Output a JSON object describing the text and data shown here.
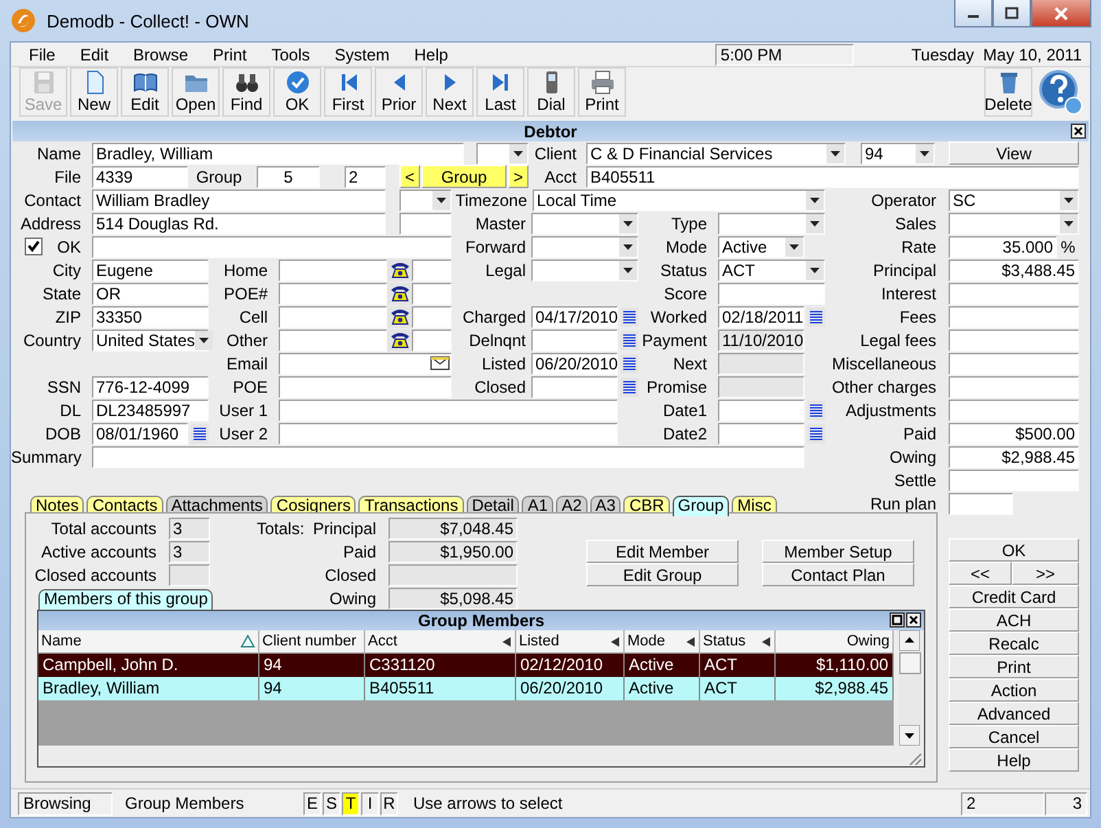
{
  "window": {
    "title": "Demodb - Collect! - OWN"
  },
  "menu": [
    "File",
    "Edit",
    "Browse",
    "Print",
    "Tools",
    "System",
    "Help"
  ],
  "clock": {
    "time": "5:00 PM",
    "date": "Tuesday  May 10, 2011"
  },
  "toolbar": [
    {
      "label": "Save",
      "disabled": true
    },
    {
      "label": "New",
      "disabled": false
    },
    {
      "label": "Edit",
      "disabled": false
    },
    {
      "label": "Open",
      "disabled": false
    },
    {
      "label": "Find",
      "disabled": false
    },
    {
      "label": "OK",
      "disabled": false
    },
    {
      "label": "First",
      "disabled": false
    },
    {
      "label": "Prior",
      "disabled": false
    },
    {
      "label": "Next",
      "disabled": false
    },
    {
      "label": "Last",
      "disabled": false
    },
    {
      "label": "Dial",
      "disabled": false
    },
    {
      "label": "Print",
      "disabled": false
    }
  ],
  "toolbar_right": [
    {
      "label": "Delete",
      "disabled": false
    }
  ],
  "debtor": {
    "title": "Debtor",
    "items": [
      {
        "kind": "label",
        "text": "Name"
      },
      {
        "kind": "field",
        "value": "Bradley, William"
      },
      {
        "kind": "combo"
      },
      {
        "kind": "label",
        "text": "Client"
      },
      {
        "kind": "combo",
        "value": "C & D Financial Services"
      },
      {
        "kind": "combo",
        "value": "94"
      },
      {
        "kind": "button",
        "label": "View",
        "highlighted": false
      },
      {
        "kind": "label",
        "text": "File"
      },
      {
        "kind": "field",
        "value": "4339"
      },
      {
        "kind": "label",
        "text": "Group"
      },
      {
        "kind": "field",
        "value": "5"
      },
      {
        "kind": "field",
        "value": "2"
      },
      {
        "kind": "button",
        "label": "<",
        "highlighted": true
      },
      {
        "kind": "button",
        "label": "Group",
        "highlighted": true
      },
      {
        "kind": "button",
        "label": ">",
        "highlighted": true
      },
      {
        "kind": "label",
        "text": "Acct"
      },
      {
        "kind": "field",
        "value": "B405511"
      },
      {
        "kind": "label",
        "text": "Contact"
      },
      {
        "kind": "field",
        "value": "William Bradley"
      },
      {
        "kind": "combo"
      },
      {
        "kind": "label",
        "text": "Timezone"
      },
      {
        "kind": "combo",
        "value": "Local Time"
      },
      {
        "kind": "label",
        "text": "Operator"
      },
      {
        "kind": "combo",
        "value": "SC"
      },
      {
        "kind": "label",
        "text": "Address"
      },
      {
        "kind": "field",
        "value": "514 Douglas Rd."
      },
      {
        "kind": "field"
      },
      {
        "kind": "label",
        "text": "Master"
      },
      {
        "kind": "combo"
      },
      {
        "kind": "label",
        "text": "Type"
      },
      {
        "kind": "combo"
      },
      {
        "kind": "label",
        "text": "Sales"
      },
      {
        "kind": "combo"
      },
      {
        "kind": "checkbox",
        "checked": true
      },
      {
        "kind": "label",
        "text": "OK"
      },
      {
        "kind": "field"
      },
      {
        "kind": "label",
        "text": "Forward"
      },
      {
        "kind": "combo"
      },
      {
        "kind": "label",
        "text": "Mode"
      },
      {
        "kind": "combo",
        "value": "Active"
      },
      {
        "kind": "label",
        "text": "Rate"
      },
      {
        "kind": "field",
        "value": "35.000"
      },
      {
        "kind": "label",
        "text": "%"
      },
      {
        "kind": "label",
        "text": "City"
      },
      {
        "kind": "field",
        "value": "Eugene"
      },
      {
        "kind": "label",
        "text": "Home"
      },
      {
        "kind": "field"
      },
      {
        "kind": "phone"
      },
      {
        "kind": "field"
      },
      {
        "kind": "label",
        "text": "Legal"
      },
      {
        "kind": "combo"
      },
      {
        "kind": "label",
        "text": "Status"
      },
      {
        "kind": "combo",
        "value": "ACT"
      },
      {
        "kind": "label",
        "text": "Principal"
      },
      {
        "kind": "field",
        "value": "$3,488.45"
      },
      {
        "kind": "label",
        "text": "State"
      },
      {
        "kind": "field",
        "value": "OR"
      },
      {
        "kind": "label",
        "text": "POE#"
      },
      {
        "kind": "field"
      },
      {
        "kind": "phone"
      },
      {
        "kind": "field"
      },
      {
        "kind": "label",
        "text": "Score"
      },
      {
        "kind": "field"
      },
      {
        "kind": "label",
        "text": "Interest"
      },
      {
        "kind": "field"
      },
      {
        "kind": "label",
        "text": "ZIP"
      },
      {
        "kind": "field",
        "value": "33350"
      },
      {
        "kind": "label",
        "text": "Cell"
      },
      {
        "kind": "field"
      },
      {
        "kind": "phone"
      },
      {
        "kind": "field"
      },
      {
        "kind": "label",
        "text": "Charged"
      },
      {
        "kind": "date",
        "value": "04/17/2010"
      },
      {
        "kind": "label",
        "text": "Worked"
      },
      {
        "kind": "date",
        "value": "02/18/2011"
      },
      {
        "kind": "label",
        "text": "Fees"
      },
      {
        "kind": "field"
      },
      {
        "kind": "label",
        "text": "Country"
      },
      {
        "kind": "combo",
        "value": "United States"
      },
      {
        "kind": "label",
        "text": "Other"
      },
      {
        "kind": "field"
      },
      {
        "kind": "phone"
      },
      {
        "kind": "field"
      },
      {
        "kind": "label",
        "text": "Delnqnt"
      },
      {
        "kind": "date"
      },
      {
        "kind": "label",
        "text": "Payment"
      },
      {
        "kind": "display",
        "value": "11/10/2010"
      },
      {
        "kind": "label",
        "text": "Legal fees"
      },
      {
        "kind": "field"
      },
      {
        "kind": "label",
        "text": "Email"
      },
      {
        "kind": "email"
      },
      {
        "kind": "label",
        "text": "Listed"
      },
      {
        "kind": "date",
        "value": "06/20/2010"
      },
      {
        "kind": "label",
        "text": "Next"
      },
      {
        "kind": "display"
      },
      {
        "kind": "label",
        "text": "Miscellaneous"
      },
      {
        "kind": "field"
      },
      {
        "kind": "label",
        "text": "SSN"
      },
      {
        "kind": "field",
        "value": "776-12-4099"
      },
      {
        "kind": "label",
        "text": "POE"
      },
      {
        "kind": "field"
      },
      {
        "kind": "label",
        "text": "Closed"
      },
      {
        "kind": "date"
      },
      {
        "kind": "label",
        "text": "Promise"
      },
      {
        "kind": "display"
      },
      {
        "kind": "label",
        "text": "Other charges"
      },
      {
        "kind": "field"
      },
      {
        "kind": "label",
        "text": "DL"
      },
      {
        "kind": "field",
        "value": "DL23485997"
      },
      {
        "kind": "label",
        "text": "User 1"
      },
      {
        "kind": "field"
      },
      {
        "kind": "label",
        "text": "Date1"
      },
      {
        "kind": "date"
      },
      {
        "kind": "label",
        "text": "Adjustments"
      },
      {
        "kind": "field"
      },
      {
        "kind": "label",
        "text": "DOB"
      },
      {
        "kind": "date",
        "value": "08/01/1960"
      },
      {
        "kind": "label",
        "text": "User 2"
      },
      {
        "kind": "field"
      },
      {
        "kind": "label",
        "text": "Date2"
      },
      {
        "kind": "date"
      },
      {
        "kind": "label",
        "text": "Paid"
      },
      {
        "kind": "field",
        "value": "$500.00"
      },
      {
        "kind": "label",
        "text": "Summary"
      },
      {
        "kind": "field"
      },
      {
        "kind": "label",
        "text": "Owing"
      },
      {
        "kind": "field",
        "value": "$2,988.45"
      },
      {
        "kind": "label",
        "text": "Settle"
      },
      {
        "kind": "field"
      },
      {
        "kind": "label",
        "text": "Run plan"
      },
      {
        "kind": "field"
      }
    ]
  },
  "tabs": [
    {
      "label": "Notes",
      "color": "#ffff99",
      "selected": false
    },
    {
      "label": "Contacts",
      "color": "#ffff99",
      "selected": false
    },
    {
      "label": "Attachments",
      "color": "#d0d0d0",
      "selected": false
    },
    {
      "label": "Cosigners",
      "color": "#ffff99",
      "selected": false
    },
    {
      "label": "Transactions",
      "color": "#ffff99",
      "selected": false
    },
    {
      "label": "Detail",
      "color": "#d0d0d0",
      "selected": false
    },
    {
      "label": "A1",
      "color": "#d0d0d0",
      "selected": false
    },
    {
      "label": "A2",
      "color": "#d0d0d0",
      "selected": false
    },
    {
      "label": "A3",
      "color": "#d0d0d0",
      "selected": false
    },
    {
      "label": "CBR",
      "color": "#ffff99",
      "selected": false
    },
    {
      "label": "Group",
      "color": "#ccffff",
      "selected": true
    },
    {
      "label": "Misc",
      "color": "#ffff99",
      "selected": false
    }
  ],
  "group_panel": {
    "items": [
      {
        "kind": "label",
        "text": "Total accounts"
      },
      {
        "kind": "display",
        "value": "3"
      },
      {
        "kind": "label",
        "text": "Totals:"
      },
      {
        "kind": "label",
        "text": "Principal"
      },
      {
        "kind": "display",
        "value": "$7,048.45"
      },
      {
        "kind": "label",
        "text": "Active accounts"
      },
      {
        "kind": "display",
        "value": "3"
      },
      {
        "kind": "label",
        "text": "Paid"
      },
      {
        "kind": "display",
        "value": "$1,950.00"
      },
      {
        "kind": "button",
        "label": "Edit Member",
        "highlighted": false
      },
      {
        "kind": "button",
        "label": "Member Setup",
        "highlighted": false
      },
      {
        "kind": "label",
        "text": "Closed accounts"
      },
      {
        "kind": "display"
      },
      {
        "kind": "label",
        "text": "Closed"
      },
      {
        "kind": "display"
      },
      {
        "kind": "button",
        "label": "Edit Group",
        "highlighted": false
      },
      {
        "kind": "button",
        "label": "Contact Plan",
        "highlighted": false
      },
      {
        "kind": "subtab",
        "label": "Members of this group",
        "selected": true
      },
      {
        "kind": "label",
        "text": "Owing"
      },
      {
        "kind": "display",
        "value": "$5,098.45"
      }
    ],
    "table": {
      "title": "Group Members",
      "columns": [
        {
          "label": "Name",
          "sorted": true,
          "indexed": false
        },
        {
          "label": "Client number",
          "sorted": false,
          "indexed": false
        },
        {
          "label": "Acct",
          "sorted": false,
          "indexed": true
        },
        {
          "label": "Listed",
          "sorted": false,
          "indexed": true
        },
        {
          "label": "Mode",
          "sorted": false,
          "indexed": true
        },
        {
          "label": "Status",
          "sorted": false,
          "indexed": true
        },
        {
          "label": "Owing",
          "sorted": false,
          "indexed": false
        }
      ],
      "rows": [
        {
          "cells": [
            "Campbell, John D.",
            "94",
            "C331120",
            "02/12/2010",
            "Active",
            "ACT",
            "$1,110.00"
          ],
          "selected": true,
          "current": false
        },
        {
          "cells": [
            "Bradley, William",
            "94",
            "B405511",
            "06/20/2010",
            "Active",
            "ACT",
            "$2,988.45"
          ],
          "selected": false,
          "current": true
        }
      ]
    }
  },
  "side_buttons": [
    "OK",
    "<<",
    ">>",
    "Credit Card",
    "ACH",
    "Recalc",
    "Print",
    "Action",
    "Advanced",
    "Cancel",
    "Help"
  ],
  "status_bar": {
    "mode": "Browsing",
    "view": "Group Members",
    "flags": [
      {
        "label": "E",
        "on": false
      },
      {
        "label": "S",
        "on": false
      },
      {
        "label": "T",
        "on": true
      },
      {
        "label": "I",
        "on": false
      },
      {
        "label": "R",
        "on": false
      }
    ],
    "hint": "Use arrows to select",
    "counters": [
      "2",
      "3"
    ]
  }
}
